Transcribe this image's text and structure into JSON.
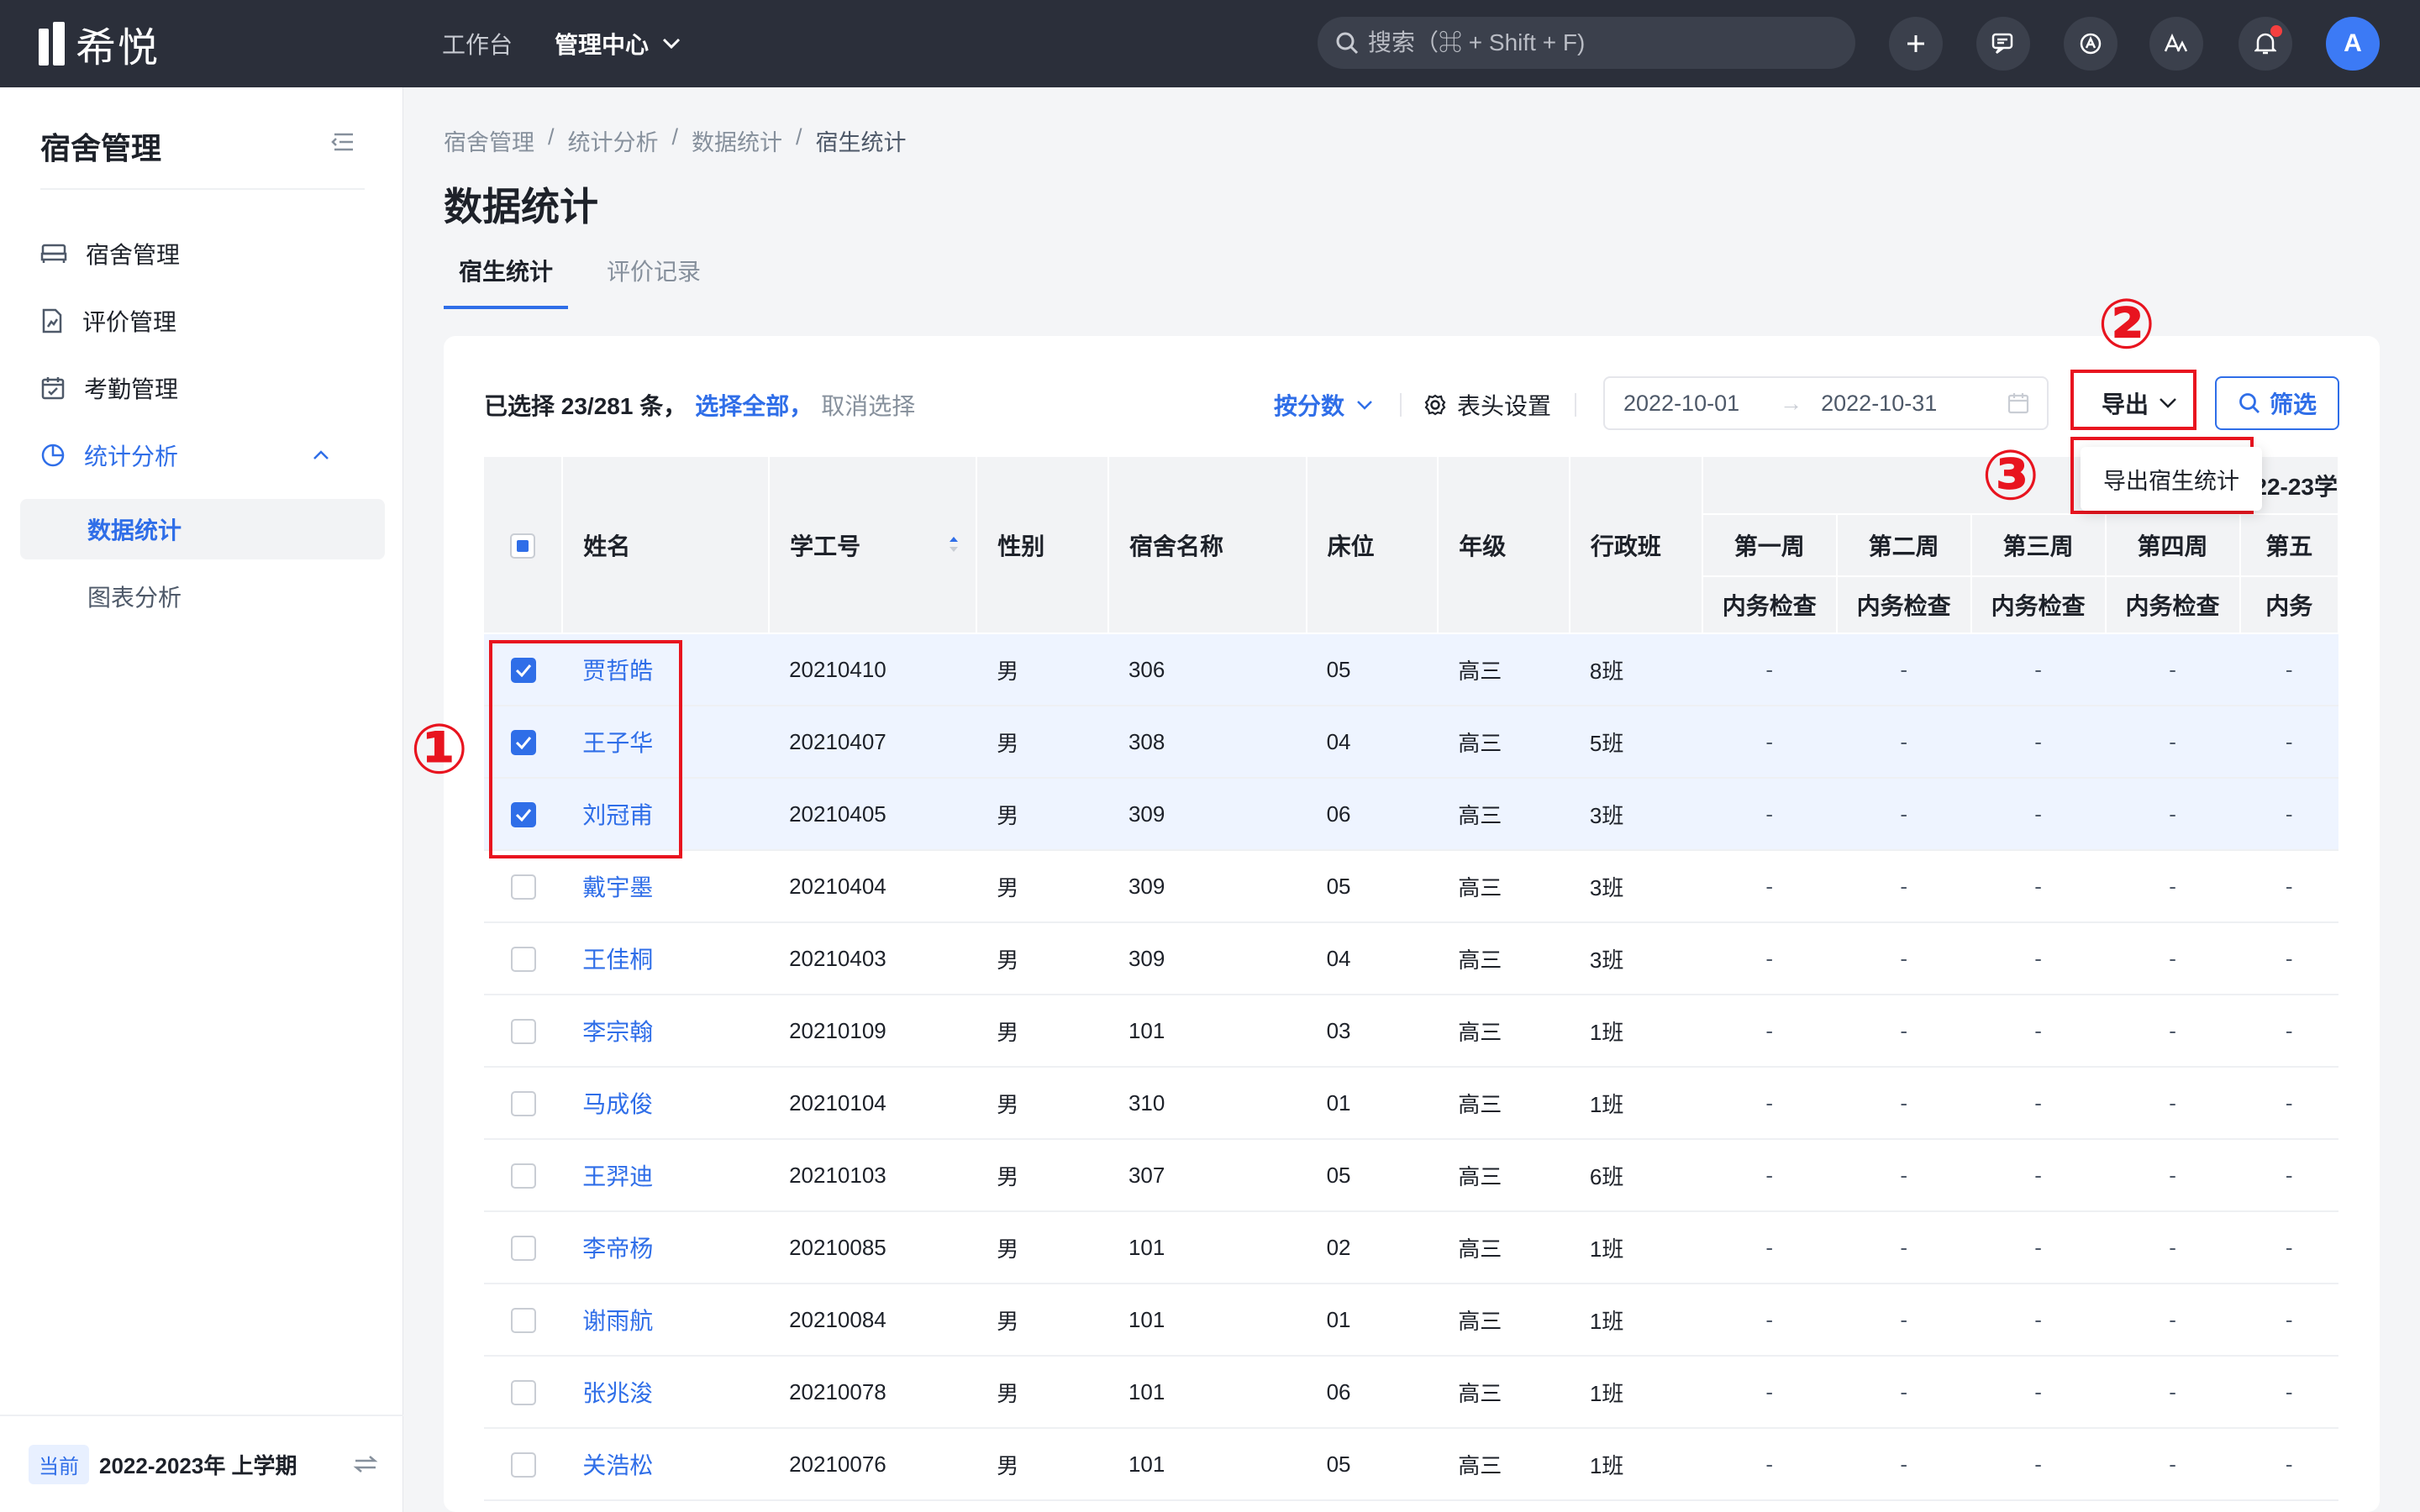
{
  "topbar": {
    "logo_text": "希悦",
    "nav": [
      {
        "label": "工作台"
      },
      {
        "label": "管理中心"
      }
    ],
    "search_placeholder": "搜索（⌘ + Shift + F)",
    "avatar_letter": "A",
    "icons": [
      "plus-icon",
      "message-icon",
      "app-icon",
      "font-icon",
      "bell-icon"
    ]
  },
  "sidebar": {
    "title": "宿舍管理",
    "items": [
      {
        "label": "宿舍管理",
        "icon": "bed-icon"
      },
      {
        "label": "评价管理",
        "icon": "document-chart-icon"
      },
      {
        "label": "考勤管理",
        "icon": "calendar-icon"
      },
      {
        "label": "统计分析",
        "icon": "pie-chart-icon"
      }
    ],
    "sub_items": [
      {
        "label": "数据统计"
      },
      {
        "label": "图表分析"
      }
    ],
    "footer": {
      "tag": "当前",
      "term": "2022-2023年 上学期"
    }
  },
  "breadcrumb": [
    "宿舍管理",
    "统计分析",
    "数据统计",
    "宿生统计"
  ],
  "page_title": "数据统计",
  "tabs": [
    {
      "label": "宿生统计"
    },
    {
      "label": "评价记录"
    }
  ],
  "toolbar": {
    "selected_text": "已选择 23/281 条，",
    "select_all": "选择全部，",
    "cancel_select": "取消选择",
    "by_score": "按分数",
    "header_settings": "表头设置",
    "date_start": "2022-10-01",
    "date_end": "2022-10-31",
    "export": "导出",
    "filter": "筛选",
    "export_menu_item": "导出宿生统计"
  },
  "callouts": {
    "one": "①",
    "two": "②",
    "three": "③"
  },
  "table": {
    "headers": {
      "name": "姓名",
      "student_id": "学工号",
      "gender": "性别",
      "dorm": "宿舍名称",
      "bed": "床位",
      "grade": "年级",
      "class": "行政班",
      "group": "2022-23学",
      "weeks": [
        "第一周",
        "第二周",
        "第三周",
        "第四周",
        "第五"
      ],
      "sub": [
        "内务检查",
        "内务检查",
        "内务检查",
        "内务检查",
        "内务"
      ]
    },
    "rows": [
      {
        "name": "贾哲皓",
        "id": "20210410",
        "gender": "男",
        "dorm": "306",
        "bed": "05",
        "grade": "高三",
        "class": "8班",
        "w": [
          "-",
          "-",
          "-",
          "-",
          "-"
        ],
        "selected": true
      },
      {
        "name": "王子华",
        "id": "20210407",
        "gender": "男",
        "dorm": "308",
        "bed": "04",
        "grade": "高三",
        "class": "5班",
        "w": [
          "-",
          "-",
          "-",
          "-",
          "-"
        ],
        "selected": true
      },
      {
        "name": "刘冠甫",
        "id": "20210405",
        "gender": "男",
        "dorm": "309",
        "bed": "06",
        "grade": "高三",
        "class": "3班",
        "w": [
          "-",
          "-",
          "-",
          "-",
          "-"
        ],
        "selected": true
      },
      {
        "name": "戴宇墨",
        "id": "20210404",
        "gender": "男",
        "dorm": "309",
        "bed": "05",
        "grade": "高三",
        "class": "3班",
        "w": [
          "-",
          "-",
          "-",
          "-",
          "-"
        ],
        "selected": false
      },
      {
        "name": "王佳桐",
        "id": "20210403",
        "gender": "男",
        "dorm": "309",
        "bed": "04",
        "grade": "高三",
        "class": "3班",
        "w": [
          "-",
          "-",
          "-",
          "-",
          "-"
        ],
        "selected": false
      },
      {
        "name": "李宗翰",
        "id": "20210109",
        "gender": "男",
        "dorm": "101",
        "bed": "03",
        "grade": "高三",
        "class": "1班",
        "w": [
          "-",
          "-",
          "-",
          "-",
          "-"
        ],
        "selected": false
      },
      {
        "name": "马成俊",
        "id": "20210104",
        "gender": "男",
        "dorm": "310",
        "bed": "01",
        "grade": "高三",
        "class": "1班",
        "w": [
          "-",
          "-",
          "-",
          "-",
          "-"
        ],
        "selected": false
      },
      {
        "name": "王羿迪",
        "id": "20210103",
        "gender": "男",
        "dorm": "307",
        "bed": "05",
        "grade": "高三",
        "class": "6班",
        "w": [
          "-",
          "-",
          "-",
          "-",
          "-"
        ],
        "selected": false
      },
      {
        "name": "李帝杨",
        "id": "20210085",
        "gender": "男",
        "dorm": "101",
        "bed": "02",
        "grade": "高三",
        "class": "1班",
        "w": [
          "-",
          "-",
          "-",
          "-",
          "-"
        ],
        "selected": false
      },
      {
        "name": "谢雨航",
        "id": "20210084",
        "gender": "男",
        "dorm": "101",
        "bed": "01",
        "grade": "高三",
        "class": "1班",
        "w": [
          "-",
          "-",
          "-",
          "-",
          "-"
        ],
        "selected": false
      },
      {
        "name": "张兆浚",
        "id": "20210078",
        "gender": "男",
        "dorm": "101",
        "bed": "06",
        "grade": "高三",
        "class": "1班",
        "w": [
          "-",
          "-",
          "-",
          "-",
          "-"
        ],
        "selected": false
      },
      {
        "name": "关浩松",
        "id": "20210076",
        "gender": "男",
        "dorm": "101",
        "bed": "05",
        "grade": "高三",
        "class": "1班",
        "w": [
          "-",
          "-",
          "-",
          "-",
          "-"
        ],
        "selected": false
      }
    ]
  },
  "colors": {
    "accent": "#2f6ee8",
    "topbar": "#2b2f3a",
    "annotation": "#e8141f"
  }
}
